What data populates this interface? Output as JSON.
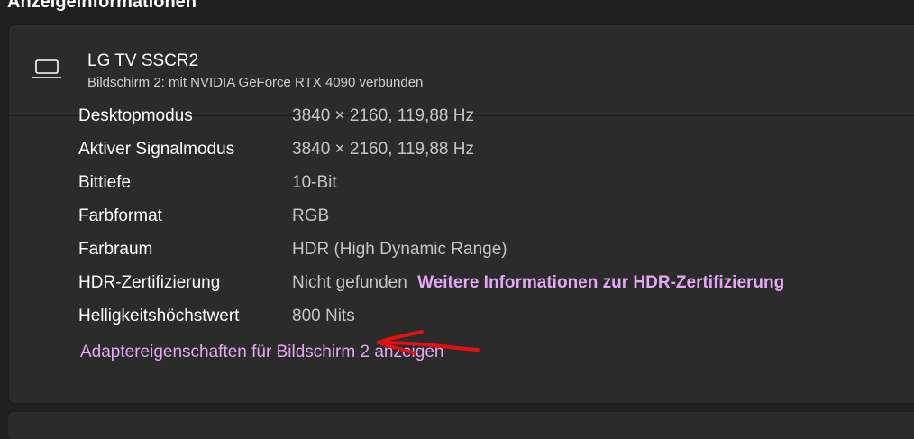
{
  "section": {
    "title": "Anzeigeinformationen"
  },
  "display": {
    "icon": "laptop-icon",
    "name": "LG TV SSCR2",
    "subtitle": "Bildschirm 2: mit NVIDIA GeForce RTX 4090 verbunden"
  },
  "details": [
    {
      "label": "Desktopmodus",
      "value": "3840 × 2160, 119,88 Hz"
    },
    {
      "label": "Aktiver Signalmodus",
      "value": "3840 × 2160, 119,88 Hz"
    },
    {
      "label": "Bittiefe",
      "value": "10-Bit"
    },
    {
      "label": "Farbformat",
      "value": "RGB"
    },
    {
      "label": "Farbraum",
      "value": "HDR (High Dynamic Range)"
    },
    {
      "label": "HDR-Zertifizierung",
      "value": "Nicht gefunden",
      "link": "Weitere Informationen zur HDR-Zertifizierung"
    },
    {
      "label": "Helligkeitshöchstwert",
      "value": "800 Nits"
    }
  ],
  "adapter_link": "Adaptereigenschaften für Bildschirm 2 anzeigen",
  "colors": {
    "background": "#202020",
    "card": "#2b2b2b",
    "link": "#e3a7f5",
    "value_text": "#c5c5c5",
    "annotation": "#e01010"
  }
}
